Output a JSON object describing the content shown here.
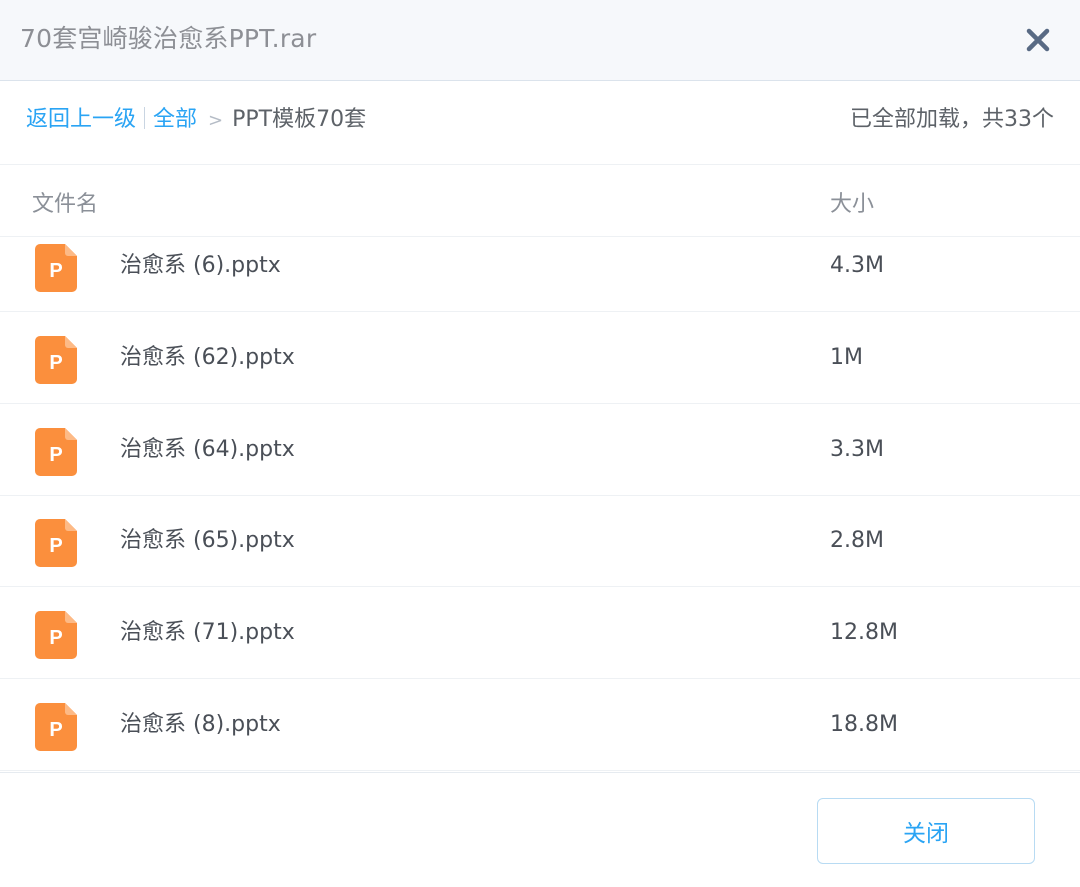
{
  "window": {
    "title": "70套宫崎骏治愈系PPT.rar",
    "close_icon": "close-x-icon"
  },
  "breadcrumb": {
    "back_label": "返回上一级",
    "all_label": "全部",
    "separator": ">",
    "current": "PPT模板70套",
    "loaded_status": "已全部加载，共33个"
  },
  "table": {
    "columns": {
      "name": "文件名",
      "size": "大小"
    },
    "rows": [
      {
        "name": "治愈系 (6).pptx",
        "size": "4.3M",
        "icon": "pptx-file-icon",
        "icon_letter": "P"
      },
      {
        "name": "治愈系 (62).pptx",
        "size": "1M",
        "icon": "pptx-file-icon",
        "icon_letter": "P"
      },
      {
        "name": "治愈系 (64).pptx",
        "size": "3.3M",
        "icon": "pptx-file-icon",
        "icon_letter": "P"
      },
      {
        "name": "治愈系 (65).pptx",
        "size": "2.8M",
        "icon": "pptx-file-icon",
        "icon_letter": "P"
      },
      {
        "name": "治愈系 (71).pptx",
        "size": "12.8M",
        "icon": "pptx-file-icon",
        "icon_letter": "P"
      },
      {
        "name": "治愈系 (8).pptx",
        "size": "18.8M",
        "icon": "pptx-file-icon",
        "icon_letter": "P"
      }
    ]
  },
  "footer": {
    "close_button_label": "关闭"
  },
  "colors": {
    "accent": "#2aa4f4",
    "file_icon": "#fb8f3d",
    "close_x": "#586a84"
  }
}
